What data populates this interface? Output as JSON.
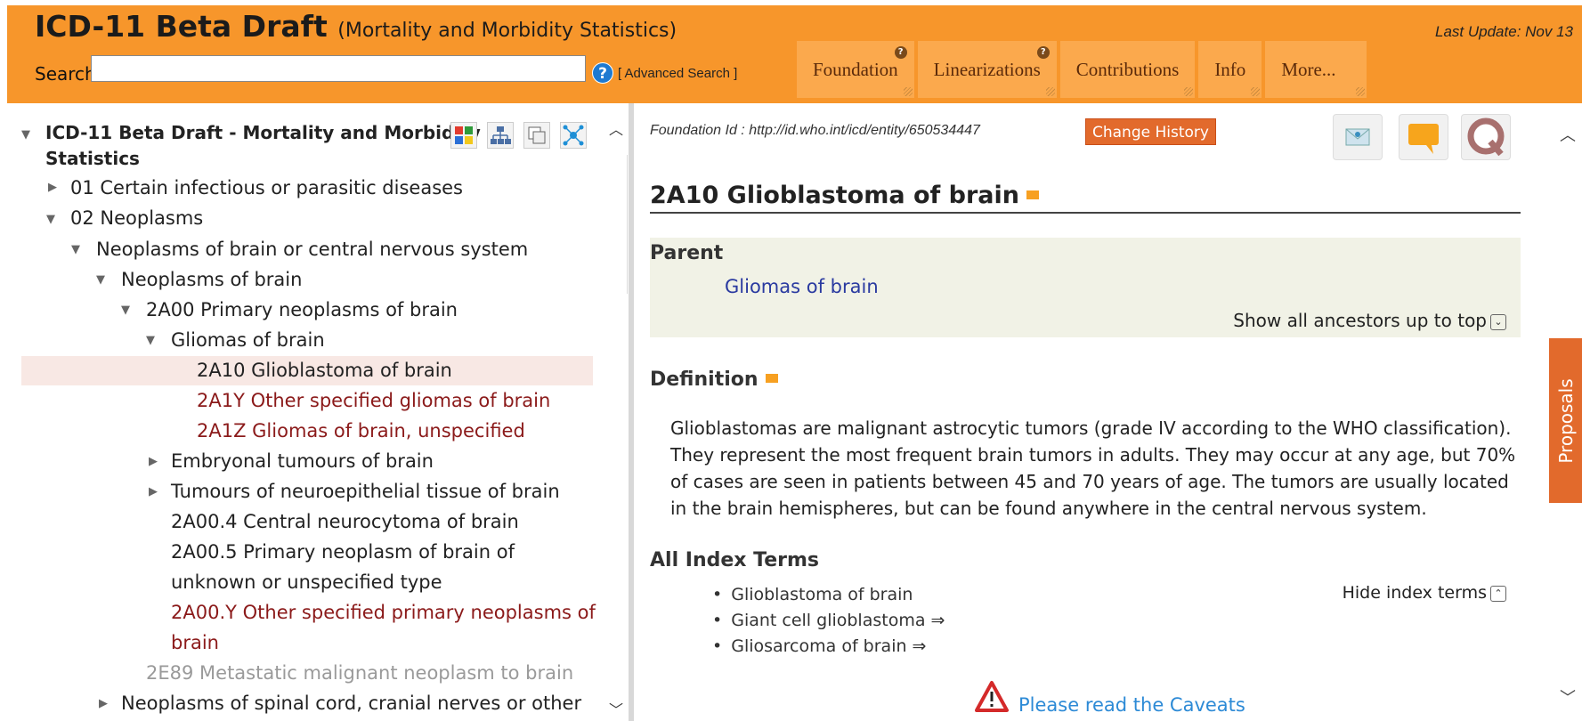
{
  "header": {
    "title": "ICD-11 Beta Draft",
    "subtitle": "(Mortality and Morbidity Statistics)",
    "last_update": "Last Update: Nov 13",
    "search_label": "Search",
    "search_value": "",
    "help_icon": "question-circle-icon",
    "advanced_search": "[ Advanced Search ]",
    "tabs": [
      "Foundation",
      "Linearizations",
      "Contributions",
      "Info",
      "More..."
    ],
    "accent_color": "#f7962b"
  },
  "tree": {
    "root_label": "ICD-11 Beta Draft - Mortality and Morbidity",
    "root_label_2": "Statistics",
    "items": [
      "01 Certain infectious or parasitic diseases",
      "02 Neoplasms",
      "Neoplasms of brain or central nervous system",
      "Neoplasms of brain",
      "2A00 Primary neoplasms of brain",
      "Gliomas of brain",
      "2A10 Glioblastoma of brain",
      "2A1Y Other specified gliomas of brain",
      "2A1Z Gliomas of brain, unspecified",
      "Embryonal tumours of brain",
      "Tumours of neuroepithelial tissue of brain",
      "2A00.4 Central neurocytoma of brain",
      "2A00.5 Primary neoplasm of brain of",
      "unknown or unspecified type",
      "2A00.Y Other specified primary neoplasms of",
      "brain",
      "2E89 Metastatic malignant neoplasm to brain",
      "Neoplasms of spinal cord, cranial nerves or other"
    ]
  },
  "detail": {
    "foundation_id": "Foundation Id : http://id.who.int/icd/entity/650534447",
    "change_history": "Change History",
    "title": "2A10 Glioblastoma of brain",
    "parent_heading": "Parent",
    "parent_link": "Gliomas of brain",
    "show_ancestors": "Show all ancestors up to top",
    "definition_heading": "Definition",
    "definition": "Glioblastomas are malignant astrocytic tumors (grade IV according to the WHO classification). They represent the most frequent brain tumors in adults. They may occur at any age, but 70% of cases are seen in patients between 45 and 70 years of age. The tumors are usually located in the brain hemispheres, but can be found anywhere in the central nervous system.",
    "index_heading": "All Index Terms",
    "index_terms": [
      "Glioblastoma of brain",
      "Giant cell glioblastoma ⇒",
      "Gliosarcoma of brain ⇒"
    ],
    "hide_index": "Hide index terms",
    "caveats": "Please read the Caveats",
    "proposals": "Proposals"
  }
}
